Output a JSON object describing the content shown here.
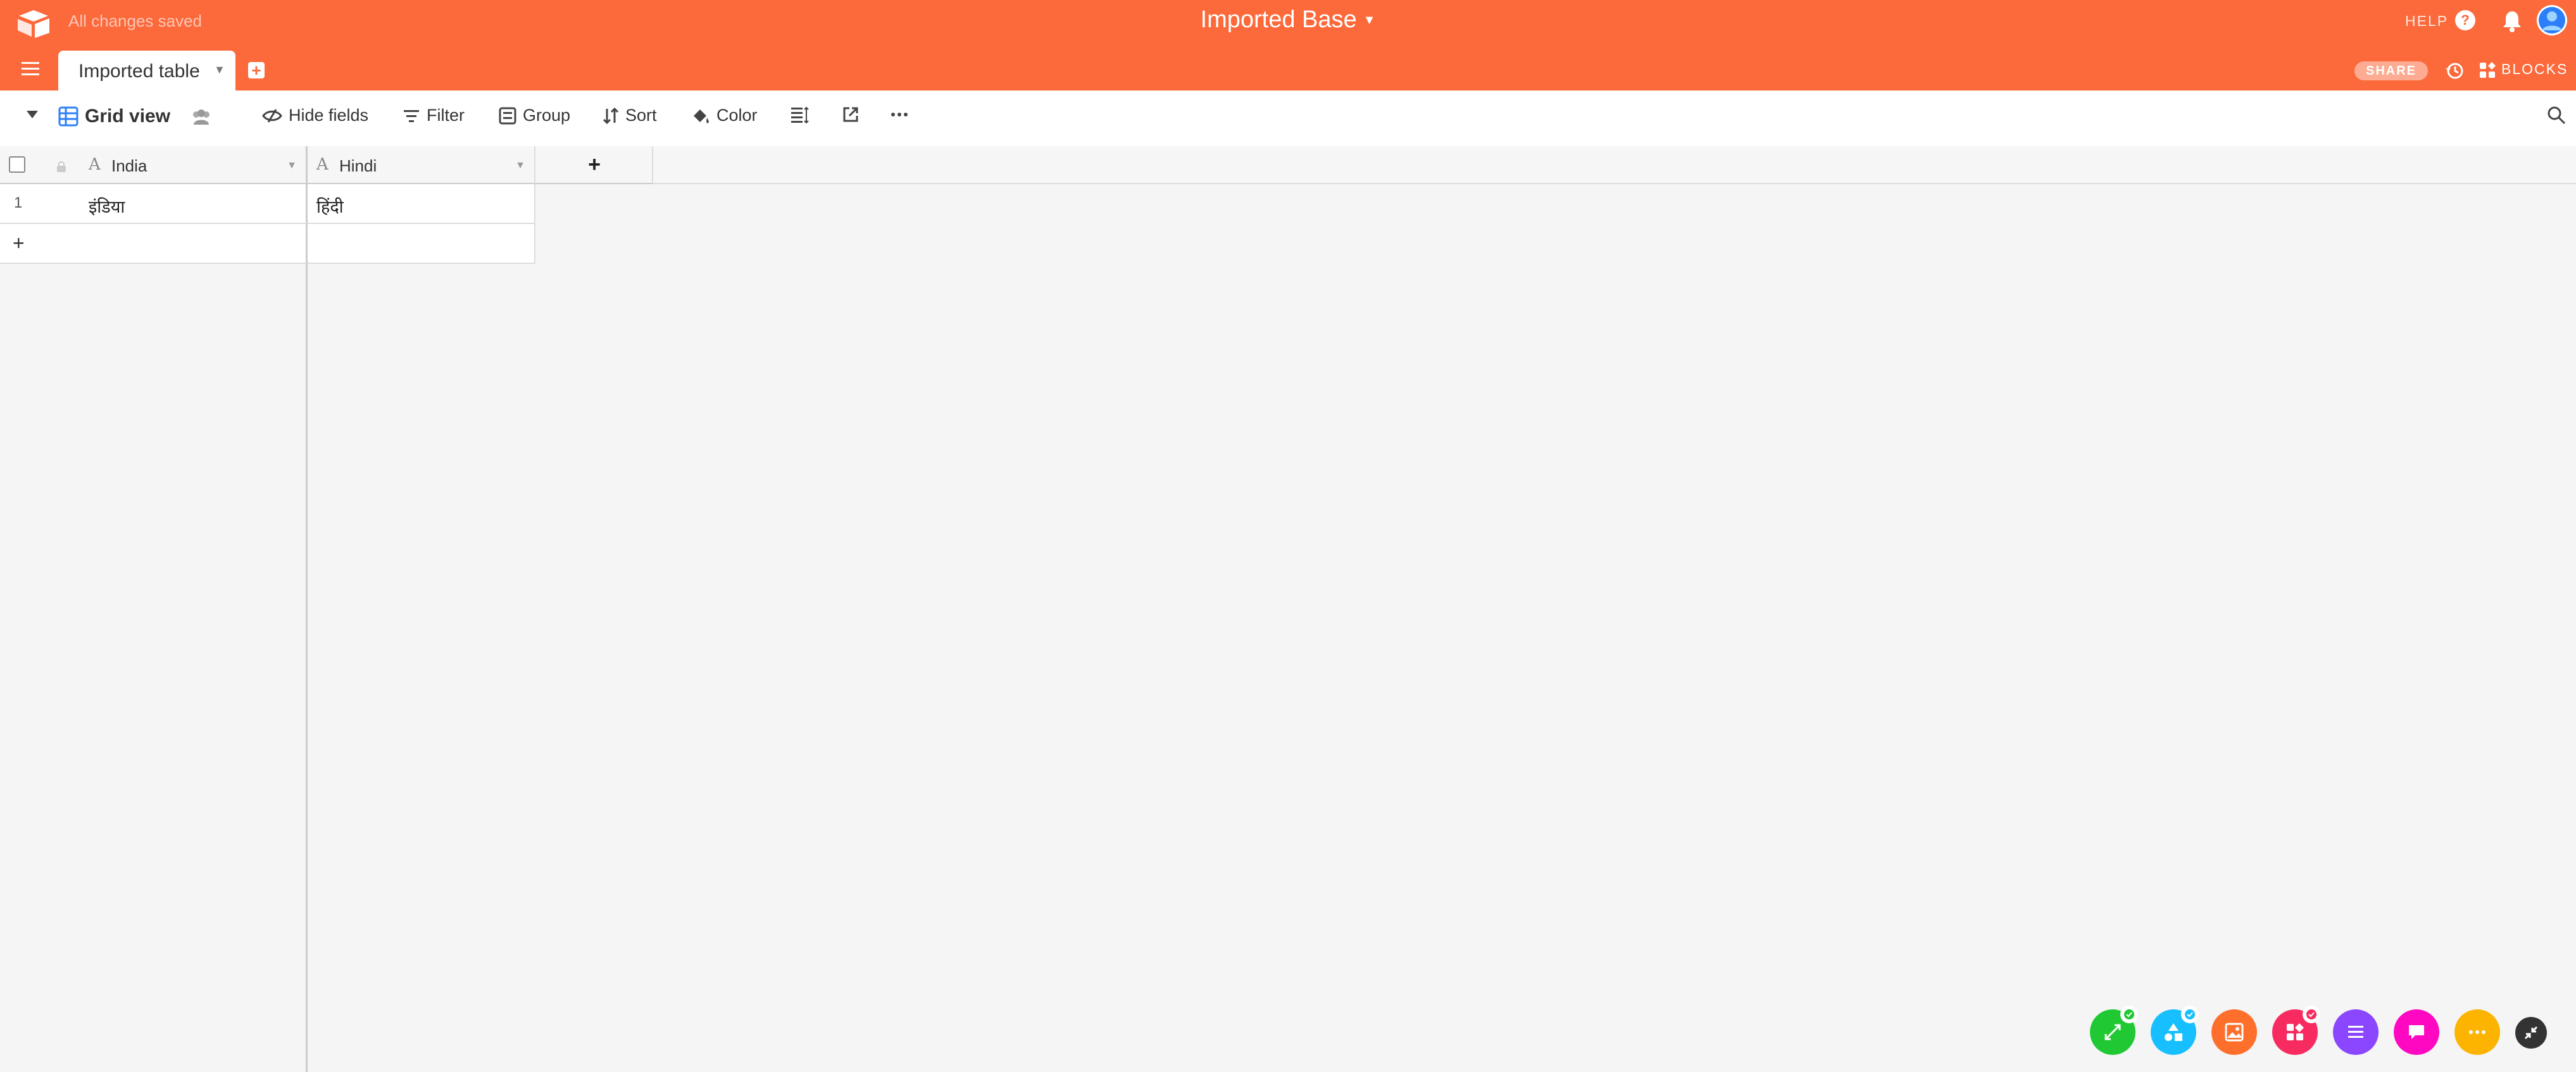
{
  "header": {
    "save_status": "All changes saved",
    "base_name": "Imported Base",
    "help_label": "HELP",
    "share_label": "SHARE",
    "blocks_label": "BLOCKS"
  },
  "tabs": [
    {
      "label": "Imported table",
      "active": true
    }
  ],
  "toolbar": {
    "view_name": "Grid view",
    "hide_fields": "Hide fields",
    "filter": "Filter",
    "group": "Group",
    "sort": "Sort",
    "color": "Color"
  },
  "table": {
    "columns": [
      {
        "name": "India",
        "type_icon": "A"
      },
      {
        "name": "Hindi",
        "type_icon": "A"
      }
    ],
    "add_column_label": "+",
    "rows": [
      {
        "number": "1",
        "cells": [
          "इंडिया",
          "हिंदी"
        ]
      }
    ],
    "add_row_label": "+"
  },
  "colors": {
    "brand": "#fc693b",
    "fab_green": "#20c933",
    "fab_blue": "#18bfff",
    "fab_orange": "#ff6f2c",
    "fab_red": "#f82b60",
    "fab_purple": "#8b46ff",
    "fab_pink": "#ff08c2",
    "fab_yellow": "#fcb400",
    "fab_dark": "#333333"
  }
}
